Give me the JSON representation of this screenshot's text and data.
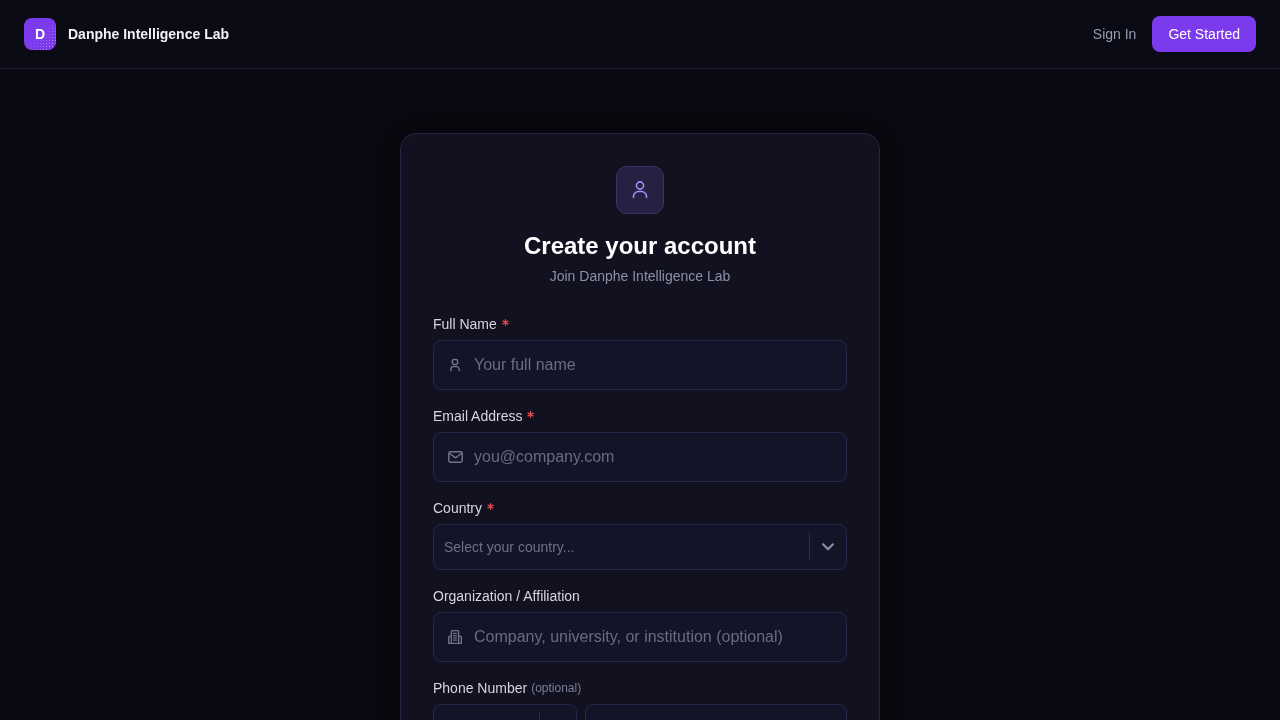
{
  "header": {
    "logo_letter": "D",
    "brand": "Danphe Intelligence Lab",
    "sign_in": "Sign In",
    "get_started": "Get Started"
  },
  "signup_card": {
    "title": "Create your account",
    "subtitle": "Join Danphe Intelligence Lab",
    "fields": [
      {
        "kind": "name",
        "label": "Full Name",
        "required": true,
        "placeholder": "Your full name"
      },
      {
        "kind": "email",
        "label": "Email Address",
        "required": true,
        "placeholder": "you@company.com"
      },
      {
        "kind": "select",
        "label": "Country",
        "required": true,
        "placeholder": "Select your country..."
      },
      {
        "kind": "organization",
        "label": "Organization / Affiliation",
        "required": false,
        "placeholder": "Company, university, or institution (optional)"
      },
      {
        "kind": "phone",
        "label": "Phone Number",
        "required": false,
        "note": "(optional)"
      }
    ]
  }
}
